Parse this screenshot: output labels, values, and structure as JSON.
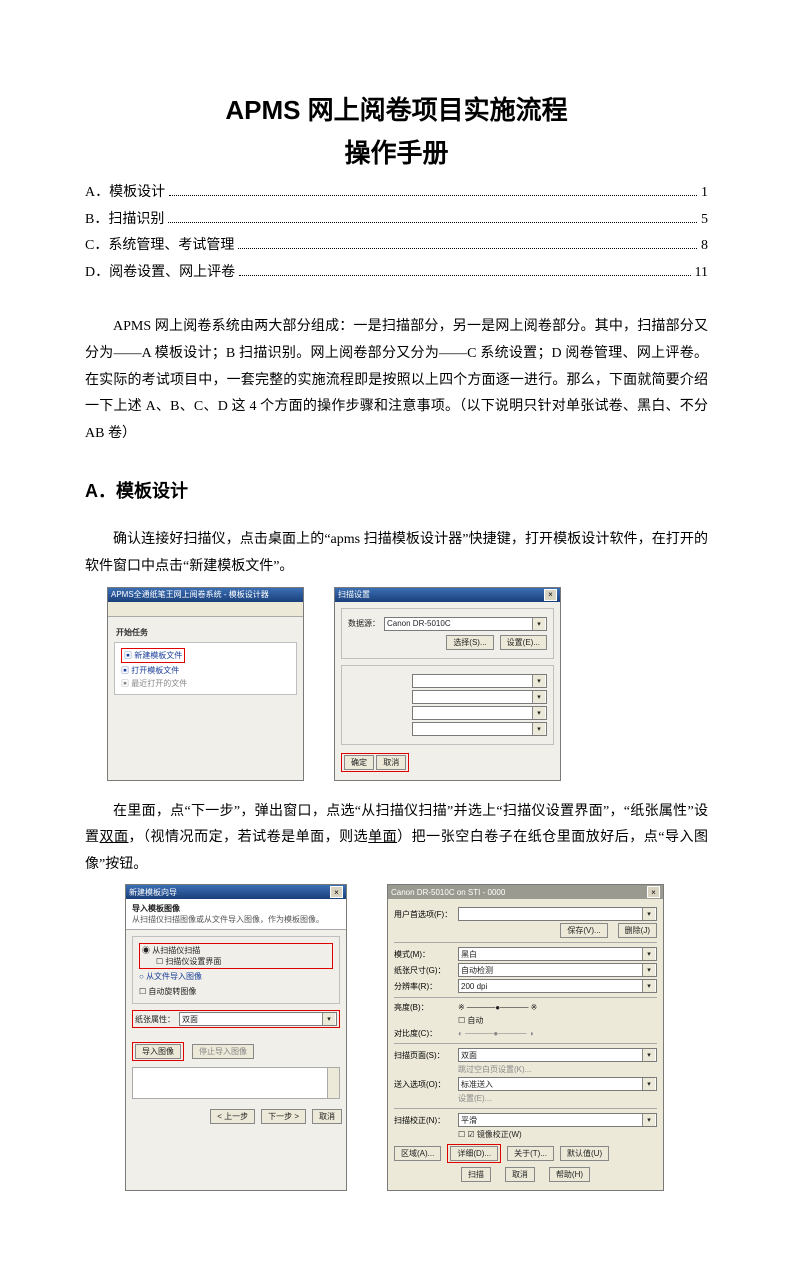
{
  "title": "APMS 网上阅卷项目实施流程",
  "subtitle": "操作手册",
  "toc": [
    {
      "label": "A．模板设计",
      "page": "1"
    },
    {
      "label": "B．扫描识别",
      "page": "5"
    },
    {
      "label": "C．系统管理、考试管理",
      "page": "8"
    },
    {
      "label": "D．阅卷设置、网上评卷",
      "page": "11"
    }
  ],
  "intro": "APMS 网上阅卷系统由两大部分组成：一是扫描部分，另一是网上阅卷部分。其中，扫描部分又分为——A 模板设计；B 扫描识别。网上阅卷部分又分为——C 系统设置；D 阅卷管理、网上评卷。在实际的考试项目中，一套完整的实施流程即是按照以上四个方面逐一进行。那么，下面就简要介绍一下上述 A、B、C、D 这 4 个方面的操作步骤和注意事项。（以下说明只针对单张试卷、黑白、不分 AB 卷）",
  "sectionA": {
    "heading": "A．模板设计",
    "p1": "确认连接好扫描仪，点击桌面上的“apms 扫描模板设计器”快捷键，打开模板设计软件，在打开的软件窗口中点击“新建模板文件”。",
    "p2_a": "在里面，点“下一步”，弹出窗口，点选“从扫描仪扫描”并选上“扫描仪设置界面”，“纸张属性”设置",
    "p2_u1": "双面",
    "p2_b": "，（视情况而定，若试卷是单面，则选",
    "p2_u2": "单面",
    "p2_c": "）把一张空白卷子在纸仓里面放好后，点“导入图像”按钮。"
  },
  "fig1": {
    "title": "APMS全通纸笔王网上阅卷系统 - 模板设计器",
    "groupLabel": "开始任务",
    "item_new": "新建模板文件",
    "item_open": "打开模板文件",
    "item_recent": "最近打开的文件"
  },
  "fig2": {
    "title": "扫描设置",
    "src_label": "数据源：",
    "src_value": "Canon DR-5010C",
    "btn_select": "选择(S)...",
    "btn_setup": "设置(E)...",
    "ok": "确定",
    "cancel": "取消"
  },
  "fig3": {
    "title": "新建模板向导",
    "heading": "导入模板图像",
    "sub": "从扫描仪扫描图像或从文件导入图像，作为模板图像。",
    "r1": "从扫描仪扫描",
    "r1_chk": "扫描仪设置界面",
    "r2": "从文件导入图像",
    "chk_rotate": "自动旋转图像",
    "paper_label": "纸张属性：",
    "paper_value": "双面",
    "btn_import": "导入图像",
    "btn_stop": "停止导入图像",
    "back": "< 上一步",
    "next": "下一步 >",
    "cancel": "取消"
  },
  "fig4": {
    "title": "Canon DR-5010C on STI - 0000",
    "user_label": "用户首选项(F)：",
    "btn_save": "保存(V)...",
    "btn_del": "删除(J)",
    "mode_label": "模式(M)：",
    "mode_value": "黑白",
    "size_label": "纸张尺寸(G)：",
    "size_value": "自动检测",
    "dpi_label": "分辨率(R)：",
    "dpi_value": "200 dpi",
    "bright_label": "亮度(B)：",
    "bright_auto": "自动",
    "contrast_label": "对比度(C)：",
    "side_label": "扫描页面(S)：",
    "side_value": "双面",
    "skip_label": "跳过空白页设置(K)...",
    "feed_label": "送入选项(O)：",
    "feed_value": "标准送入",
    "feed_set": "设置(E)...",
    "deskew_label": "扫描校正(N)：",
    "deskew_value": "平滑",
    "mirror_chk": "镜像校正(W)",
    "area": "区域(A)...",
    "more": "详细(D)...",
    "about": "关于(T)...",
    "default": "默认值(U)",
    "scan": "扫描",
    "cancel": "取消",
    "help": "帮助(H)"
  }
}
